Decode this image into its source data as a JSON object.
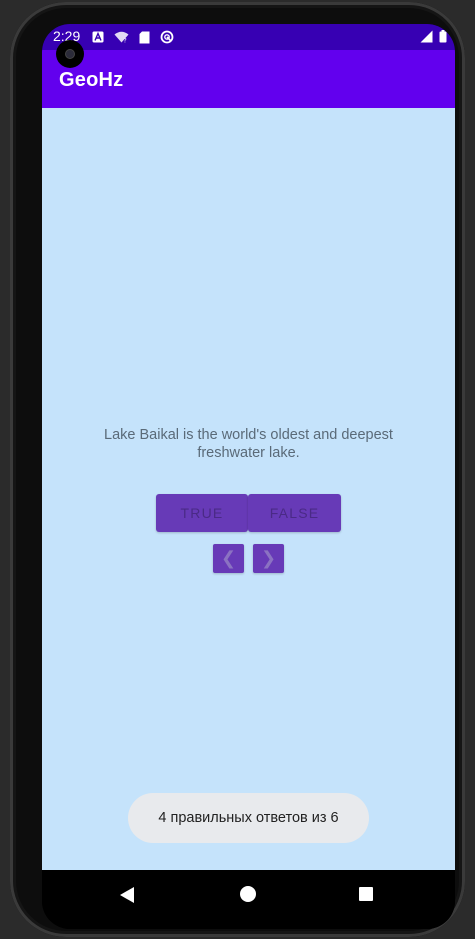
{
  "status_bar": {
    "time": "2:29",
    "icons": [
      "a-notification-icon",
      "wifi-question-icon",
      "sd-card-icon",
      "sync-icon"
    ],
    "right_icons": [
      "signal-icon",
      "battery-icon"
    ],
    "bg_color": "#3700b3"
  },
  "app_bar": {
    "title": "GeoHz",
    "bg_color": "#6200ee"
  },
  "quiz": {
    "question": "Lake Baikal is the world's oldest and deepest freshwater lake.",
    "true_label": "TRUE",
    "false_label": "FALSE",
    "prev_label": "❮",
    "next_label": "❯",
    "button_color": "#673ab7",
    "bg_color": "#c5e3fb"
  },
  "toast": {
    "message": "4 правильных ответов из 6"
  },
  "nav_bar": {
    "back": "back-icon",
    "home": "home-icon",
    "recents": "recents-icon"
  }
}
